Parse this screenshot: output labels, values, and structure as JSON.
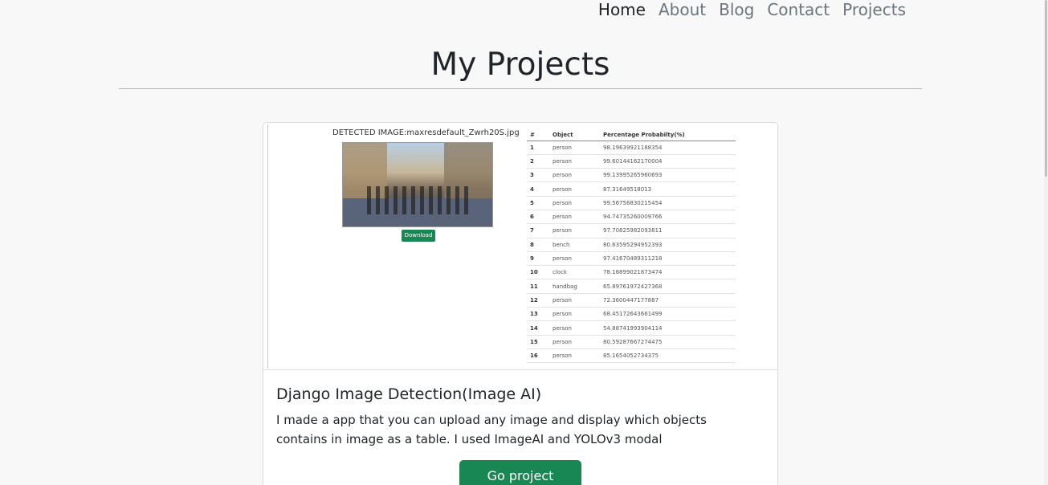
{
  "nav": {
    "items": [
      {
        "label": "Home",
        "active": true
      },
      {
        "label": "About",
        "active": false
      },
      {
        "label": "Blog",
        "active": false
      },
      {
        "label": "Contact",
        "active": false
      },
      {
        "label": "Projects",
        "active": false
      }
    ]
  },
  "page": {
    "title": "My Projects"
  },
  "project": {
    "screenshot": {
      "detected_title": "DETECTED IMAGE:maxresdefault_Zwrh20S.jpg",
      "download_label": "Download",
      "table_headers": [
        "#",
        "Object",
        "Percentage Probabilty(%)"
      ],
      "rows": [
        [
          "1",
          "person",
          "98.19639921188354"
        ],
        [
          "2",
          "person",
          "99.60144162170004"
        ],
        [
          "3",
          "person",
          "99.13995265960693"
        ],
        [
          "4",
          "person",
          "87.31649518013"
        ],
        [
          "5",
          "person",
          "99.56756830215454"
        ],
        [
          "6",
          "person",
          "94.74735260009766"
        ],
        [
          "7",
          "person",
          "97.70825982093811"
        ],
        [
          "8",
          "bench",
          "80.63595294952393"
        ],
        [
          "9",
          "person",
          "97.41670489311218"
        ],
        [
          "10",
          "clock",
          "78.18899021873474"
        ],
        [
          "11",
          "handbag",
          "65.89761972427368"
        ],
        [
          "12",
          "person",
          "72.3600447177887"
        ],
        [
          "13",
          "person",
          "68.45172643661499"
        ],
        [
          "14",
          "person",
          "54.88741993904114"
        ],
        [
          "15",
          "person",
          "80.59287667274475"
        ],
        [
          "16",
          "person",
          "85.1654052734375"
        ]
      ]
    },
    "title": "Django Image Detection(Image AI)",
    "description": "I made a app that you can upload any image and display which objects contains in image as a table. I used ImageAI and YOLOv3 modal",
    "button_label": "Go project",
    "button_color": "#198754"
  }
}
